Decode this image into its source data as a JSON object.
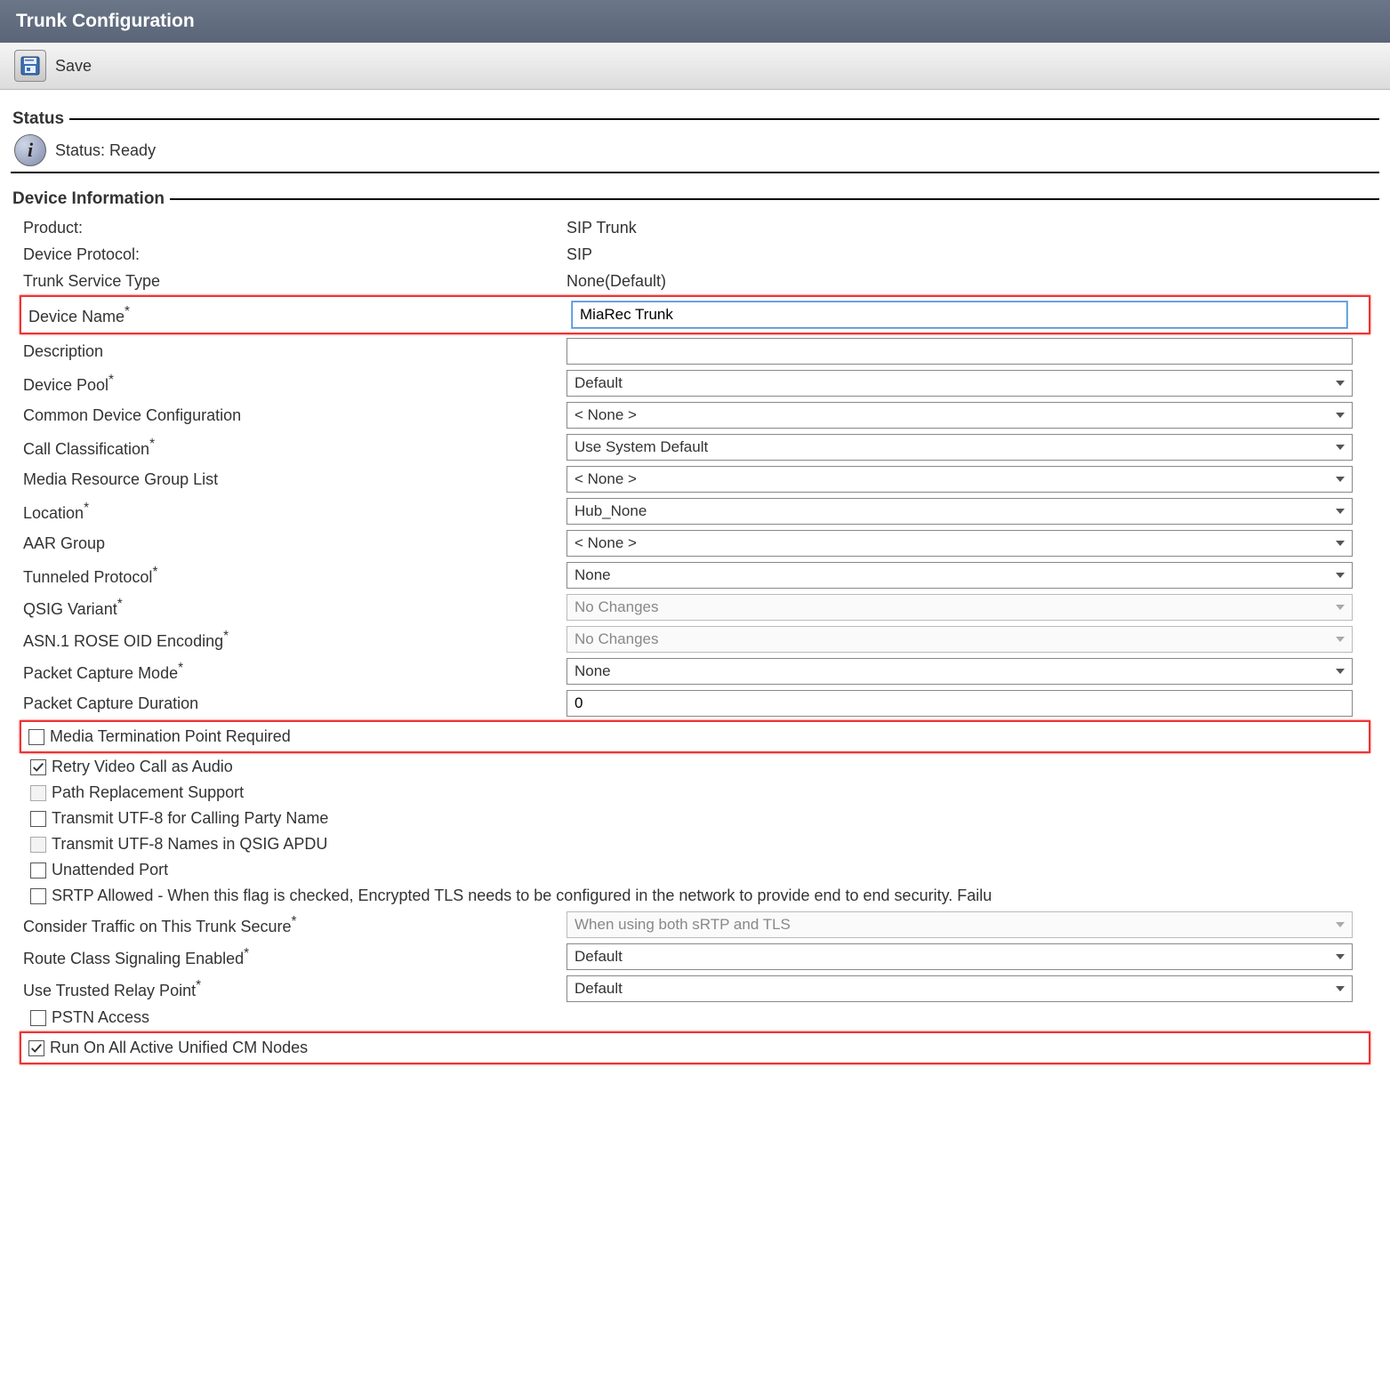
{
  "page_title": "Trunk Configuration",
  "toolbar": {
    "save_label": "Save"
  },
  "status": {
    "legend": "Status",
    "text": "Status: Ready"
  },
  "device_info": {
    "legend": "Device Information",
    "product_label": "Product:",
    "product_value": "SIP Trunk",
    "protocol_label": "Device Protocol:",
    "protocol_value": "SIP",
    "service_type_label": "Trunk Service Type",
    "service_type_value": "None(Default)",
    "device_name_label": "Device Name",
    "device_name_value": "MiaRec Trunk",
    "description_label": "Description",
    "description_value": "",
    "device_pool_label": "Device Pool",
    "device_pool_value": "Default",
    "cdc_label": "Common Device Configuration",
    "cdc_value": "< None >",
    "call_class_label": "Call Classification",
    "call_class_value": "Use System Default",
    "mrgl_label": "Media Resource Group List",
    "mrgl_value": "< None >",
    "location_label": "Location",
    "location_value": "Hub_None",
    "aar_label": "AAR Group",
    "aar_value": "< None >",
    "tunneled_label": "Tunneled Protocol",
    "tunneled_value": "None",
    "qsig_label": "QSIG Variant",
    "qsig_value": "No Changes",
    "asn1_label": "ASN.1 ROSE OID Encoding",
    "asn1_value": "No Changes",
    "pcap_mode_label": "Packet Capture Mode",
    "pcap_mode_value": "None",
    "pcap_dur_label": "Packet Capture Duration",
    "pcap_dur_value": "0",
    "mtp_label": "Media Termination Point Required",
    "retry_video_label": "Retry Video Call as Audio",
    "path_repl_label": "Path Replacement Support",
    "utf8_cpn_label": "Transmit UTF-8 for Calling Party Name",
    "utf8_qsig_label": "Transmit UTF-8 Names in QSIG APDU",
    "unattended_label": "Unattended Port",
    "srtp_label": "SRTP Allowed - When this flag is checked, Encrypted TLS needs to be configured in the network to provide end to end security. Failu",
    "consider_traffic_label": "Consider Traffic on This Trunk Secure",
    "consider_traffic_value": "When using both sRTP and TLS",
    "route_class_label": "Route Class Signaling Enabled",
    "route_class_value": "Default",
    "trusted_relay_label": "Use Trusted Relay Point",
    "trusted_relay_value": "Default",
    "pstn_label": "PSTN Access",
    "run_all_label": "Run On All Active Unified CM Nodes"
  },
  "asterisk": "*"
}
